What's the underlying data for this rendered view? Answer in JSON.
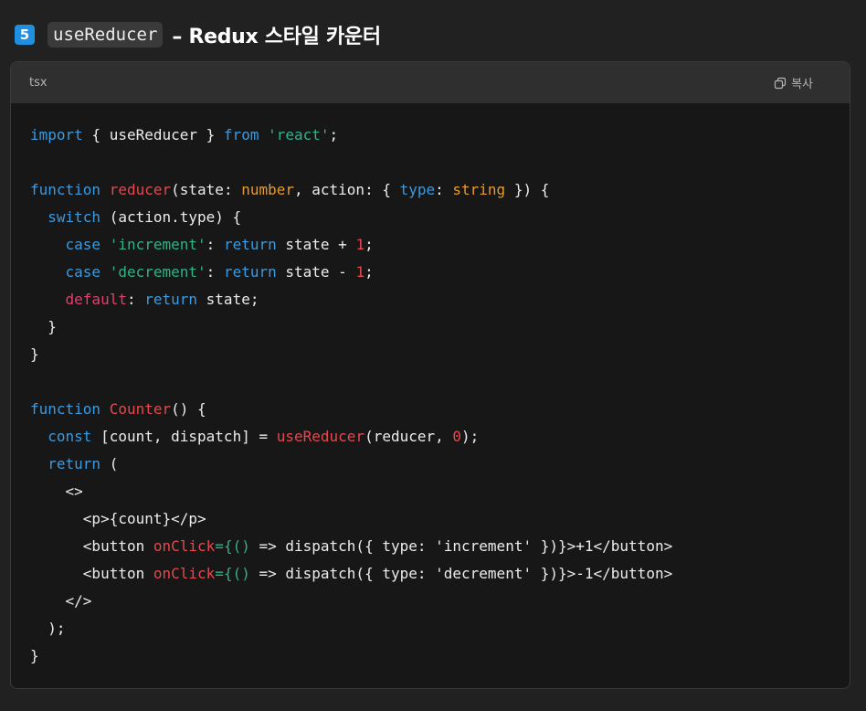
{
  "heading": {
    "number": "5",
    "inline_code": "useReducer",
    "title": "– Redux 스타일 카운터"
  },
  "code_block": {
    "language": "tsx",
    "copy_label": "복사",
    "copy_icon": "copy-icon",
    "colors": {
      "keyword": "#3b9ae0",
      "control_keyword": "#e0406a",
      "string": "#2fb38a",
      "function": "#e5484d",
      "type": "#e79a2c",
      "number": "#e5484d",
      "text": "#ececec"
    },
    "lines": [
      [
        {
          "t": "import",
          "c": "kw"
        },
        {
          "t": " { useReducer } "
        },
        {
          "t": "from",
          "c": "kw"
        },
        {
          "t": " "
        },
        {
          "t": "'react'",
          "c": "str"
        },
        {
          "t": ";"
        }
      ],
      [],
      [
        {
          "t": "function",
          "c": "kw"
        },
        {
          "t": " "
        },
        {
          "t": "reducer",
          "c": "fn"
        },
        {
          "t": "(state: "
        },
        {
          "t": "number",
          "c": "typ"
        },
        {
          "t": ", action: { "
        },
        {
          "t": "type",
          "c": "kw"
        },
        {
          "t": ": "
        },
        {
          "t": "string",
          "c": "typ"
        },
        {
          "t": " }) {"
        }
      ],
      [
        {
          "t": "  "
        },
        {
          "t": "switch",
          "c": "kw"
        },
        {
          "t": " (action.type) {"
        }
      ],
      [
        {
          "t": "    "
        },
        {
          "t": "case",
          "c": "kw"
        },
        {
          "t": " "
        },
        {
          "t": "'increment'",
          "c": "str"
        },
        {
          "t": ": "
        },
        {
          "t": "return",
          "c": "kw"
        },
        {
          "t": " state + "
        },
        {
          "t": "1",
          "c": "num"
        },
        {
          "t": ";"
        }
      ],
      [
        {
          "t": "    "
        },
        {
          "t": "case",
          "c": "kw"
        },
        {
          "t": " "
        },
        {
          "t": "'decrement'",
          "c": "str"
        },
        {
          "t": ": "
        },
        {
          "t": "return",
          "c": "kw"
        },
        {
          "t": " state - "
        },
        {
          "t": "1",
          "c": "num"
        },
        {
          "t": ";"
        }
      ],
      [
        {
          "t": "    "
        },
        {
          "t": "default",
          "c": "kw2"
        },
        {
          "t": ": "
        },
        {
          "t": "return",
          "c": "kw"
        },
        {
          "t": " state;"
        }
      ],
      [
        {
          "t": "  }"
        }
      ],
      [
        {
          "t": "}"
        }
      ],
      [],
      [
        {
          "t": "function",
          "c": "kw"
        },
        {
          "t": " "
        },
        {
          "t": "Counter",
          "c": "fn"
        },
        {
          "t": "() {"
        }
      ],
      [
        {
          "t": "  "
        },
        {
          "t": "const",
          "c": "kw"
        },
        {
          "t": " [count, dispatch] = "
        },
        {
          "t": "useReducer",
          "c": "fn"
        },
        {
          "t": "(reducer, "
        },
        {
          "t": "0",
          "c": "num"
        },
        {
          "t": ");"
        }
      ],
      [
        {
          "t": "  "
        },
        {
          "t": "return",
          "c": "kw"
        },
        {
          "t": " ("
        }
      ],
      [
        {
          "t": "    <>"
        }
      ],
      [
        {
          "t": "      <p>{count}</p>"
        }
      ],
      [
        {
          "t": "      <button "
        },
        {
          "t": "onClick",
          "c": "attr"
        },
        {
          "t": "=",
          "c": "brace"
        },
        {
          "t": "{() ",
          "c": "brace"
        },
        {
          "t": "=> dispatch({ type: 'increment' })}>+1</button>"
        }
      ],
      [
        {
          "t": "      <button "
        },
        {
          "t": "onClick",
          "c": "attr"
        },
        {
          "t": "=",
          "c": "brace"
        },
        {
          "t": "{() ",
          "c": "brace"
        },
        {
          "t": "=> dispatch({ type: 'decrement' })}>-1</button>"
        }
      ],
      [
        {
          "t": "    </>"
        }
      ],
      [
        {
          "t": "  );"
        }
      ],
      [
        {
          "t": "}"
        }
      ]
    ]
  }
}
